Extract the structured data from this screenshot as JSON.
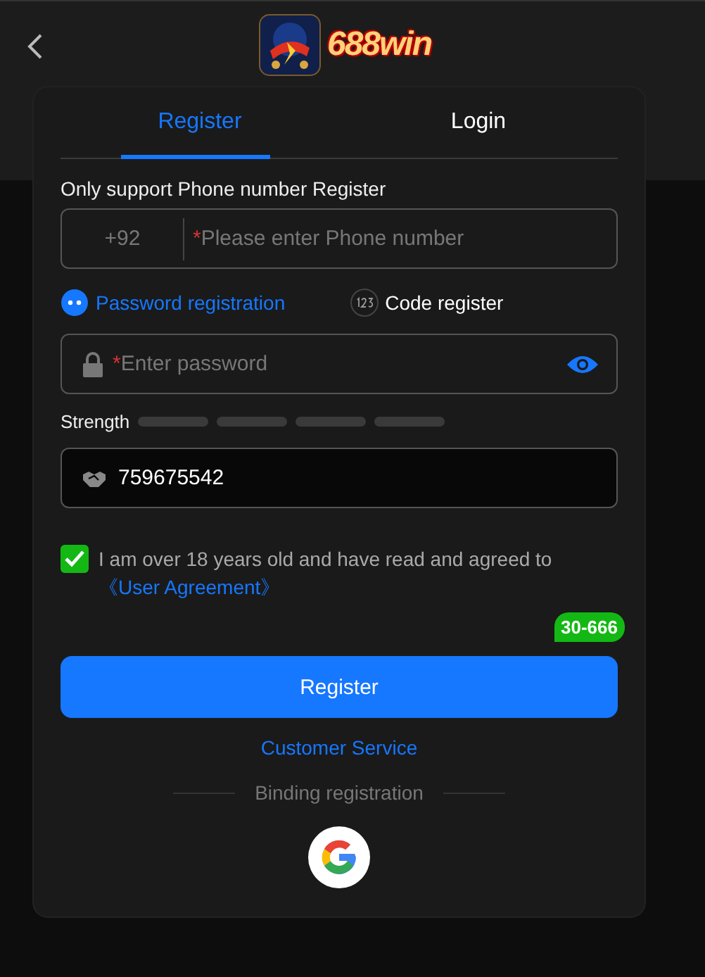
{
  "header": {
    "logo_wordmark": "688win"
  },
  "tabs": [
    {
      "label": "Register",
      "selected": true
    },
    {
      "label": "Login",
      "selected": false
    }
  ],
  "notice": "Only support Phone number Register",
  "phone_field": {
    "prefix": "+92",
    "required_mark": "*",
    "placeholder": "Please enter Phone number"
  },
  "modes": [
    {
      "label": "Password registration",
      "selected": true,
      "kind": "password"
    },
    {
      "label": "Code register",
      "selected": false,
      "kind": "code"
    }
  ],
  "password_field": {
    "required_mark": "*",
    "placeholder": "Enter password"
  },
  "strength": {
    "label": "Strength"
  },
  "invite_field": {
    "value": "759675542"
  },
  "agreement": {
    "checked": true,
    "text": "I am over 18 years old and have read and agreed to ",
    "link": "《User Agreement》"
  },
  "badge": "30-666",
  "register_button": "Register",
  "customer_service": "Customer Service",
  "binding_label": "Binding registration"
}
